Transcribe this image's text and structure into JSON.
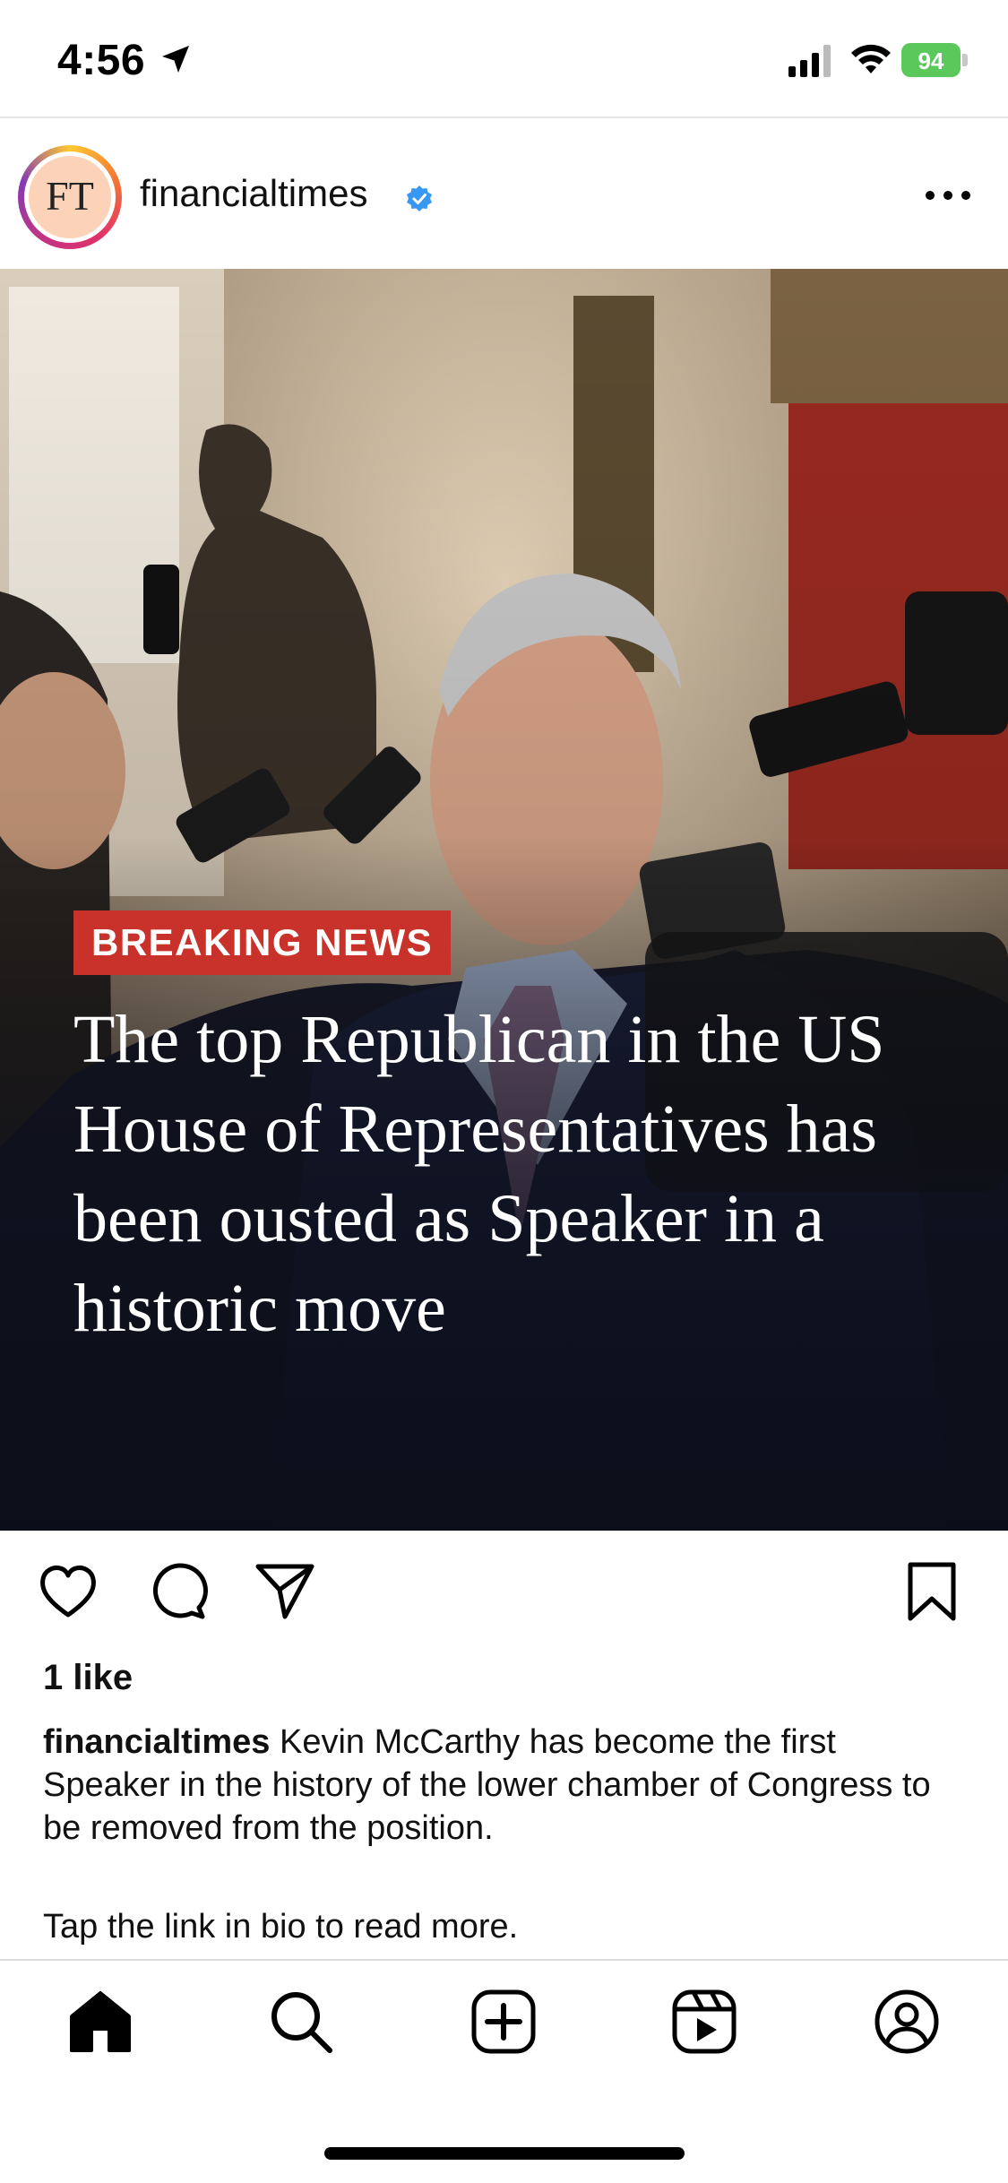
{
  "status_bar": {
    "time": "4:56",
    "battery": "94"
  },
  "post": {
    "username": "financialtimes",
    "avatar_text": "FT",
    "image": {
      "badge": "BREAKING NEWS",
      "headline": "The top Republican in the US House of Representatives has been ousted as Speaker in a historic move"
    },
    "likes": "1 like",
    "caption_user": "financialtimes",
    "caption_text": "Kevin McCarthy has become the first Speaker in the history of the lower chamber of Congress to be removed from the position.",
    "caption_more": "Tap the link in bio to read more."
  },
  "colors": {
    "badge": "#c8322a",
    "verified": "#3897f0",
    "battery": "#5ac85a"
  },
  "icons": {
    "actions": [
      "heart-icon",
      "comment-icon",
      "share-icon",
      "bookmark-icon"
    ],
    "tabs": [
      "home-icon",
      "search-icon",
      "create-icon",
      "reels-icon",
      "profile-icon"
    ]
  }
}
